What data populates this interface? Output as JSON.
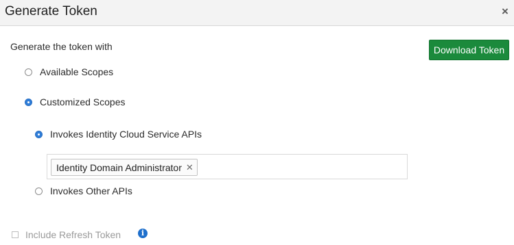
{
  "dialog": {
    "title": "Generate Token",
    "close_glyph": "×"
  },
  "form": {
    "section_label": "Generate the token with",
    "download_button_label": "Download Token",
    "scope_options": [
      {
        "label": "Available Scopes",
        "selected": false
      },
      {
        "label": "Customized Scopes",
        "selected": true
      }
    ],
    "customized_options": [
      {
        "label": "Invokes Identity Cloud Service APIs",
        "selected": true
      },
      {
        "label": "Invokes Other APIs",
        "selected": false
      }
    ],
    "selected_scope_chip": {
      "label": "Identity Domain Administrator",
      "remove_glyph": "✕"
    },
    "refresh_token": {
      "label": "Include Refresh Token",
      "checked": false
    },
    "info_glyph": "i"
  },
  "colors": {
    "primary_button": "#1b8a3c",
    "radio_selected": "#2f7dd8",
    "info_icon": "#1e6fcc"
  }
}
